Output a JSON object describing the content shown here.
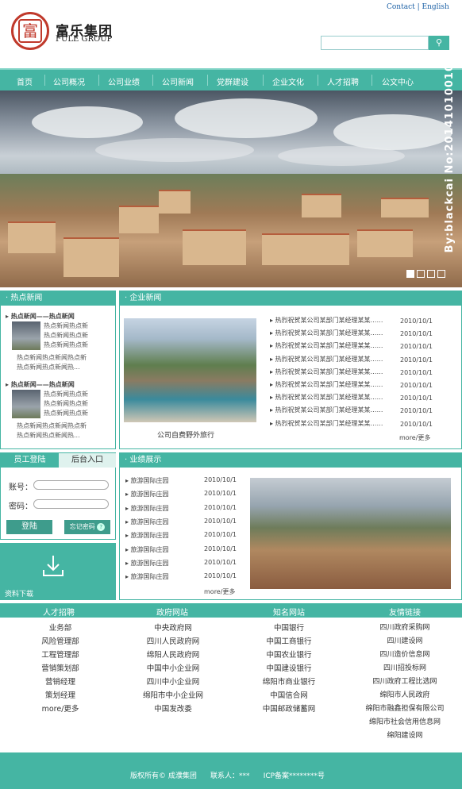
{
  "header": {
    "logo_char": "富",
    "company_cn": "富乐集团",
    "company_en": "FULE GROUP",
    "top_links": "Contact | English",
    "search_icon": "search-icon"
  },
  "nav": {
    "items": [
      "首页",
      "公司概况",
      "公司业绩",
      "公司新闻",
      "党群建设",
      "企业文化",
      "人才招聘",
      "公文中心"
    ]
  },
  "banner": {
    "watermark": "By:blackcai No:20141010010",
    "dots": 4,
    "active_dot": 0
  },
  "hot_news": {
    "title": "· 热点新闻",
    "items": [
      {
        "headline": "热点新闻——热点新闻",
        "lines": [
          "热点新闻热点新",
          "热点新闻热点新",
          "热点新闻热点新",
          "热点新闻热点新闻热点新",
          "热点新闻热点新闻热..."
        ]
      },
      {
        "headline": "热点新闻——热点新闻",
        "lines": [
          "热点新闻热点新",
          "热点新闻热点新",
          "热点新闻热点新",
          "热点新闻热点新闻热点新",
          "热点新闻热点新闻热..."
        ]
      }
    ]
  },
  "enterprise_news": {
    "title": "· 企业新闻",
    "caption": "公司自费野外旅行",
    "items": [
      {
        "text": "热烈祝贺某公司某部门某经理某某……",
        "date": "2010/10/1"
      },
      {
        "text": "热烈祝贺某公司某部门某经理某某……",
        "date": "2010/10/1"
      },
      {
        "text": "热烈祝贺某公司某部门某经理某某……",
        "date": "2010/10/1"
      },
      {
        "text": "热烈祝贺某公司某部门某经理某某……",
        "date": "2010/10/1"
      },
      {
        "text": "热烈祝贺某公司某部门某经理某某……",
        "date": "2010/10/1"
      },
      {
        "text": "热烈祝贺某公司某部门某经理某某……",
        "date": "2010/10/1"
      },
      {
        "text": "热烈祝贺某公司某部门某经理某某……",
        "date": "2010/10/1"
      },
      {
        "text": "热烈祝贺某公司某部门某经理某某……",
        "date": "2010/10/1"
      },
      {
        "text": "热烈祝贺某公司某部门某经理某某……",
        "date": "2010/10/1"
      }
    ],
    "more": "more/更多"
  },
  "login": {
    "tab_staff": "员工登陆",
    "tab_admin": "后台入口",
    "account_label": "账号：",
    "password_label": "密码：",
    "login_button": "登陆",
    "forgot_button": "忘记密码",
    "forgot_icon": "question-icon"
  },
  "download": {
    "label": "资料下载",
    "icon": "download-icon"
  },
  "performance": {
    "title": "· 业绩展示",
    "items": [
      {
        "text": "旅游国际庄园",
        "date": "2010/10/1"
      },
      {
        "text": "旅游国际庄园",
        "date": "2010/10/1"
      },
      {
        "text": "旅游国际庄园",
        "date": "2010/10/1"
      },
      {
        "text": "旅游国际庄园",
        "date": "2010/10/1"
      },
      {
        "text": "旅游国际庄园",
        "date": "2010/10/1"
      },
      {
        "text": "旅游国际庄园",
        "date": "2010/10/1"
      },
      {
        "text": "旅游国际庄园",
        "date": "2010/10/1"
      },
      {
        "text": "旅游国际庄园",
        "date": "2010/10/1"
      }
    ],
    "more": "more/更多"
  },
  "footer_links": {
    "columns": [
      {
        "title": "人才招聘",
        "items": [
          "业务部",
          "风险管理部",
          "工程管理部",
          "营销策划部",
          "营销经理",
          "策划经理",
          "more/更多"
        ]
      },
      {
        "title": "政府网站",
        "items": [
          "中央政府网",
          "四川人民政府网",
          "绵阳人民政府网",
          "中国中小企业网",
          "四川中小企业网",
          "绵阳市中小企业网",
          "中国发改委"
        ]
      },
      {
        "title": "知名网站",
        "items": [
          "中国银行",
          "中国工商银行",
          "中国农业银行",
          "中国建设银行",
          "绵阳市商业银行",
          "中国信合网",
          "中国邮政储蓄网"
        ]
      },
      {
        "title": "友情链接",
        "items": [
          "四川政府采购网",
          "四川建设网",
          "四川造价信息网",
          "四川招投标网",
          "四川政府工程比选网",
          "绵阳市人民政府",
          "绵阳市融鑫担保有限公司",
          "绵阳市社会信用信息网",
          "绵阳建设网"
        ]
      }
    ]
  },
  "copyright": {
    "line1": "版权所有© 成濮集团      联系人：***      ICP备案********号"
  },
  "colors": {
    "teal": "#45b5a3",
    "logo_red": "#c0392b"
  }
}
